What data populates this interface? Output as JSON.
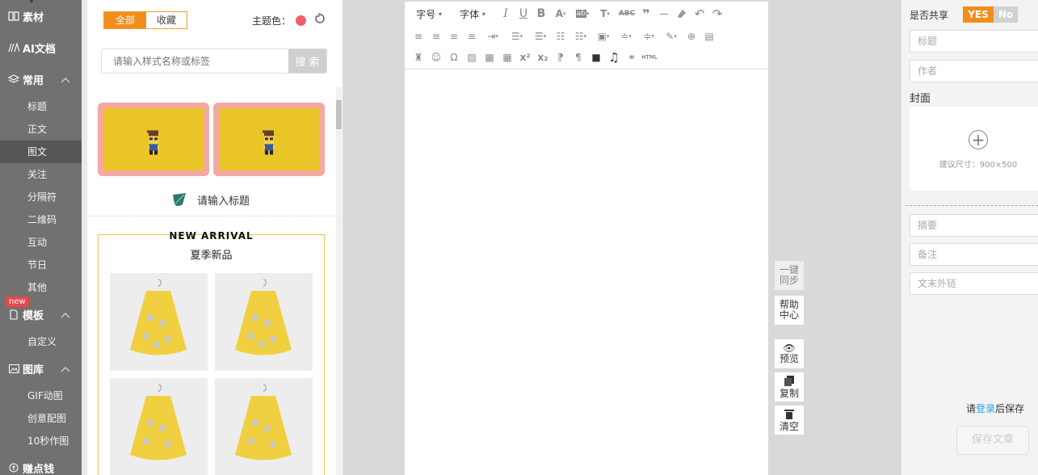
{
  "nav": {
    "sections": [
      {
        "label": "素材",
        "icon": "book-icon"
      },
      {
        "label": "AI文档",
        "icon": "ai-icon"
      },
      {
        "label": "常用",
        "icon": "layers-icon"
      },
      {
        "label": "模板",
        "icon": "template-icon"
      },
      {
        "label": "图库",
        "icon": "image-icon"
      },
      {
        "label": "赚点钱",
        "icon": "coin-icon"
      }
    ],
    "items": [
      "标题",
      "正文",
      "图文",
      "关注",
      "分隔符",
      "二维码",
      "互动",
      "节日",
      "其他"
    ],
    "template_items": [
      "自定义"
    ],
    "gallery_items": [
      "GIF动图",
      "创意配图",
      "10秒作图"
    ],
    "active_item": "图文",
    "new_badge": "new"
  },
  "panel": {
    "tabs": [
      "全部",
      "收藏"
    ],
    "theme_label": "主题色：",
    "theme_color": "#f06068",
    "search_placeholder": "请输入样式名称或标签",
    "search_button": "搜 索",
    "title_placeholder": "请输入标题",
    "arrival_title": "NEW ARRIVAL",
    "arrival_subtitle": "夏季新品",
    "card_bg": "#eac528",
    "card_border": "#f3a9a2"
  },
  "toolbar": {
    "fontsize_label": "字号",
    "font_label": "字体",
    "html_label": "HTML"
  },
  "side_buttons": [
    "一键同步",
    "帮助中心",
    "预览",
    "复制",
    "清空"
  ],
  "right": {
    "share_label": "是否共享",
    "yes": "YES",
    "no": "No",
    "title_ph": "标题",
    "author_ph": "作者",
    "cover_label": "封面",
    "cover_hint": "建议尺寸：900×500",
    "summary_ph": "摘要",
    "note_ph": "备注",
    "link_ph": "文末外链",
    "login_pre": "请",
    "login_link": "登录",
    "login_post": "后保存",
    "save_button": "保存文章"
  }
}
